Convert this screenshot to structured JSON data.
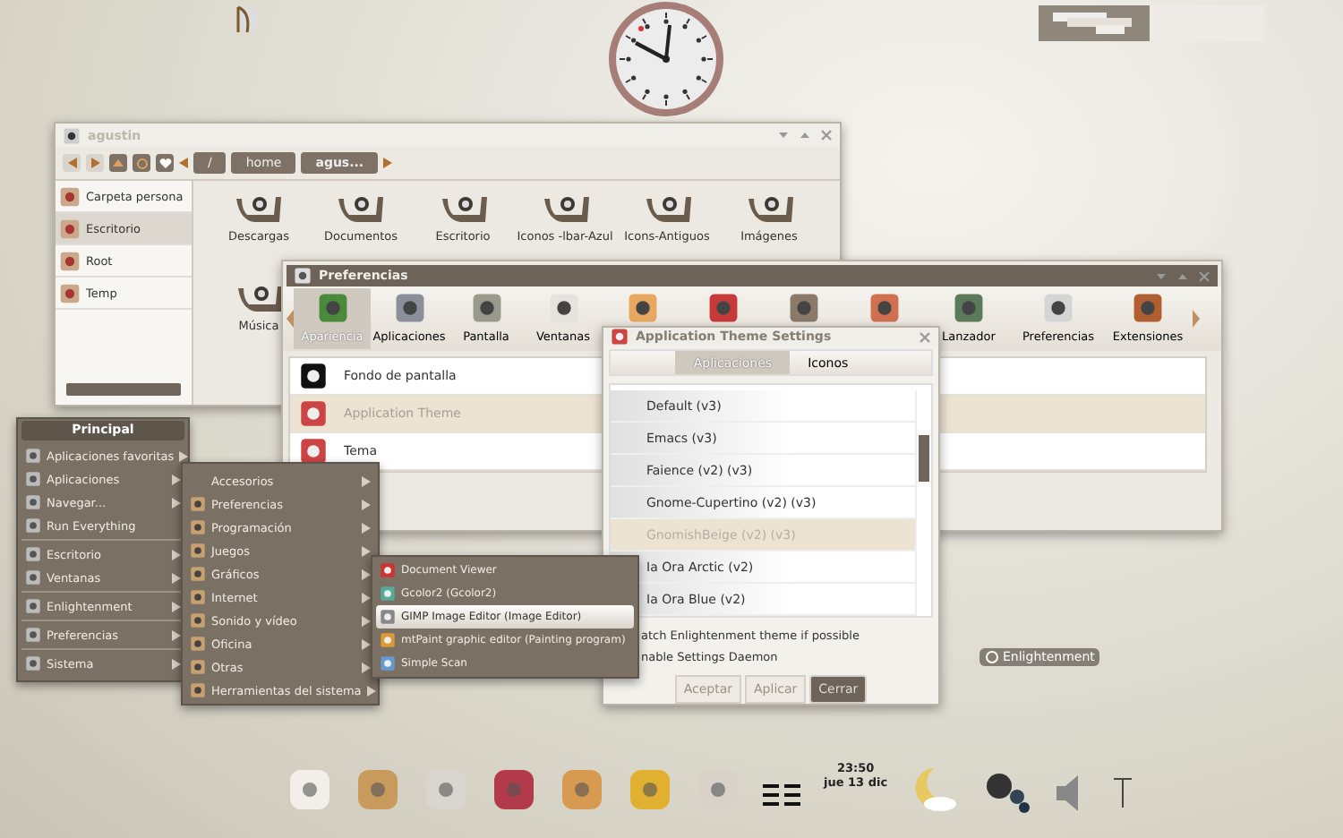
{
  "file_manager": {
    "title": "agustin",
    "path": [
      "/",
      "home",
      "agus..."
    ],
    "sidebar": [
      {
        "label": "Carpeta persona",
        "selected": false
      },
      {
        "label": "Escritorio",
        "selected": true
      },
      {
        "label": "Root",
        "selected": false
      },
      {
        "label": "Temp",
        "selected": false
      }
    ],
    "folders": [
      "Descargas",
      "Documentos",
      "Escritorio",
      "Iconos -lbar-Azul",
      "Icons-Antiguos",
      "Imágenes",
      "Música"
    ]
  },
  "preferences": {
    "title": "Preferencias",
    "categories": [
      {
        "label": "Apariencia",
        "selected": true
      },
      {
        "label": "Aplicaciones",
        "selected": false
      },
      {
        "label": "Pantalla",
        "selected": false
      },
      {
        "label": "Ventanas",
        "selected": false
      },
      {
        "selected": false
      },
      {
        "selected": false
      },
      {
        "selected": false
      },
      {
        "selected": false
      },
      {
        "label": "Lanzador",
        "selected": false
      },
      {
        "label": "Preferencias",
        "selected": false
      },
      {
        "label": "Extensiones",
        "selected": false
      }
    ],
    "items": [
      {
        "label": "Fondo de pantalla",
        "selected": false
      },
      {
        "label": "Application Theme",
        "selected": true
      },
      {
        "label": "Tema",
        "selected": false
      }
    ]
  },
  "theme_dialog": {
    "title": "Application Theme Settings",
    "tabs": [
      {
        "label": "Aplicaciones",
        "selected": true
      },
      {
        "label": "Iconos",
        "selected": false
      }
    ],
    "themes": [
      {
        "label": "Default (v3)",
        "selected": false
      },
      {
        "label": "Emacs (v3)",
        "selected": false
      },
      {
        "label": "Faience (v2) (v3)",
        "selected": false
      },
      {
        "label": "Gnome-Cupertino (v2) (v3)",
        "selected": false
      },
      {
        "label": "GnomishBeige (v2) (v3)",
        "selected": true
      },
      {
        "label": "Ia Ora Arctic (v2)",
        "selected": false
      },
      {
        "label": "Ia Ora Blue (v2)",
        "selected": false
      }
    ],
    "options": [
      "atch Enlightenment theme if possible",
      "nable Settings Daemon"
    ],
    "buttons": [
      {
        "label": "Aceptar",
        "selected": false
      },
      {
        "label": "Aplicar",
        "selected": false
      },
      {
        "label": "Cerrar",
        "selected": true
      }
    ]
  },
  "main_menu": {
    "title": "Principal",
    "groups": [
      {
        "items": [
          {
            "label": "Aplicaciones favoritas",
            "has_submenu": true
          },
          {
            "label": "Aplicaciones",
            "has_submenu": true
          },
          {
            "label": "Navegar...",
            "has_submenu": true
          },
          {
            "label": "Run Everything",
            "has_submenu": false
          }
        ]
      },
      {
        "items": [
          {
            "label": "Escritorio",
            "has_submenu": true
          },
          {
            "label": "Ventanas",
            "has_submenu": true
          }
        ]
      },
      {
        "items": [
          {
            "label": "Enlightenment",
            "has_submenu": true
          }
        ]
      },
      {
        "items": [
          {
            "label": "Preferencias",
            "has_submenu": true
          }
        ]
      },
      {
        "items": [
          {
            "label": "Sistema",
            "has_submenu": true
          }
        ]
      }
    ]
  },
  "applications_menu": {
    "items": [
      {
        "label": "Accesorios",
        "selected": false
      },
      {
        "label": "Preferencias",
        "selected": false
      },
      {
        "label": "Programación",
        "selected": false
      },
      {
        "label": "Juegos",
        "selected": false
      },
      {
        "label": "Gráficos",
        "selected": false
      },
      {
        "label": "Internet",
        "selected": false
      },
      {
        "label": "Sonido y vídeo",
        "selected": false
      },
      {
        "label": "Oficina",
        "selected": false
      },
      {
        "label": "Otras",
        "selected": false
      },
      {
        "label": "Herramientas del sistema",
        "selected": false
      }
    ]
  },
  "graphics_menu": {
    "items": [
      {
        "label": "Document Viewer",
        "selected": false
      },
      {
        "label": "Gcolor2 (Gcolor2)",
        "selected": false
      },
      {
        "label": "GIMP Image Editor (Image Editor)",
        "selected": true
      },
      {
        "label": "mtPaint graphic editor (Painting program)",
        "selected": false
      },
      {
        "label": "Simple Scan",
        "selected": false
      }
    ]
  },
  "desktop_label": "Enlightenment",
  "dock": {
    "time": "23:50",
    "date": "jue 13 dic"
  }
}
